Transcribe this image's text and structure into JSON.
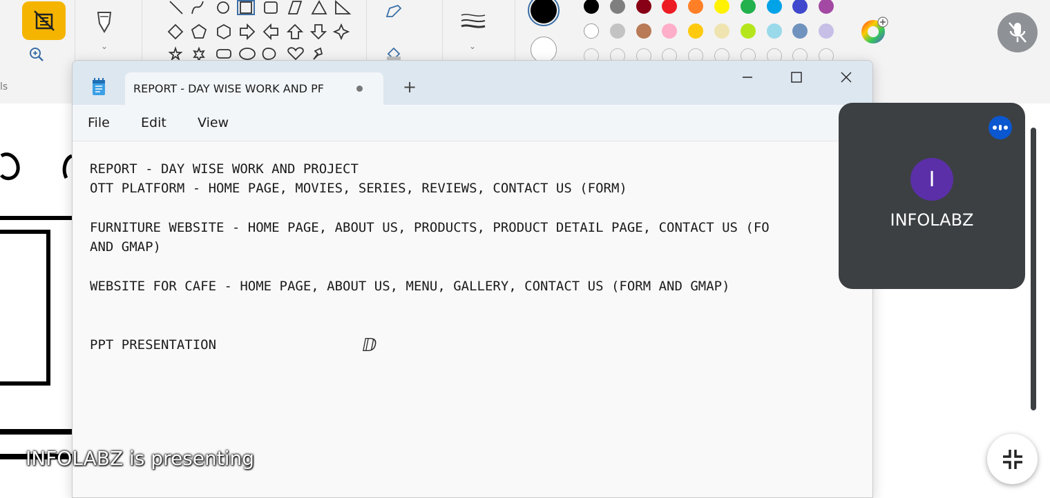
{
  "paint": {
    "group_label": "ls",
    "palette_row1": [
      "#000000",
      "#7f7f7f",
      "#880015",
      "#ed1c24",
      "#ff7f27",
      "#fff200",
      "#22b14c",
      "#00a2e8",
      "#3f48cc",
      "#a349a4"
    ],
    "palette_row2": [
      "#ffffff",
      "#c3c3c3",
      "#b97a57",
      "#ffaec9",
      "#ffc90e",
      "#efe4b0",
      "#b5e61d",
      "#99d9ea",
      "#7092be",
      "#c8bfe7"
    ]
  },
  "notepad": {
    "tab_title": "REPORT - DAY WISE WORK AND PF",
    "new_tab": "+",
    "menu": {
      "file": "File",
      "edit": "Edit",
      "view": "View"
    },
    "lines": [
      "REPORT - DAY WISE WORK AND PROJECT",
      "OTT PLATFORM - HOME PAGE, MOVIES, SERIES, REVIEWS, CONTACT US (FORM)",
      "",
      "FURNITURE WEBSITE - HOME PAGE, ABOUT US, PRODUCTS, PRODUCT DETAIL PAGE, CONTACT US (FO",
      "AND GMAP)",
      "",
      "WEBSITE FOR CAFE - HOME PAGE, ABOUT US, MENU, GALLERY, CONTACT US (FORM AND GMAP)",
      "",
      "",
      "PPT PRESENTATION"
    ]
  },
  "meet": {
    "participant_initial": "I",
    "participant_name": "INFOLABZ",
    "presenting_text": "INFOLABZ is presenting",
    "avatar_color": "#5b2fa8"
  }
}
